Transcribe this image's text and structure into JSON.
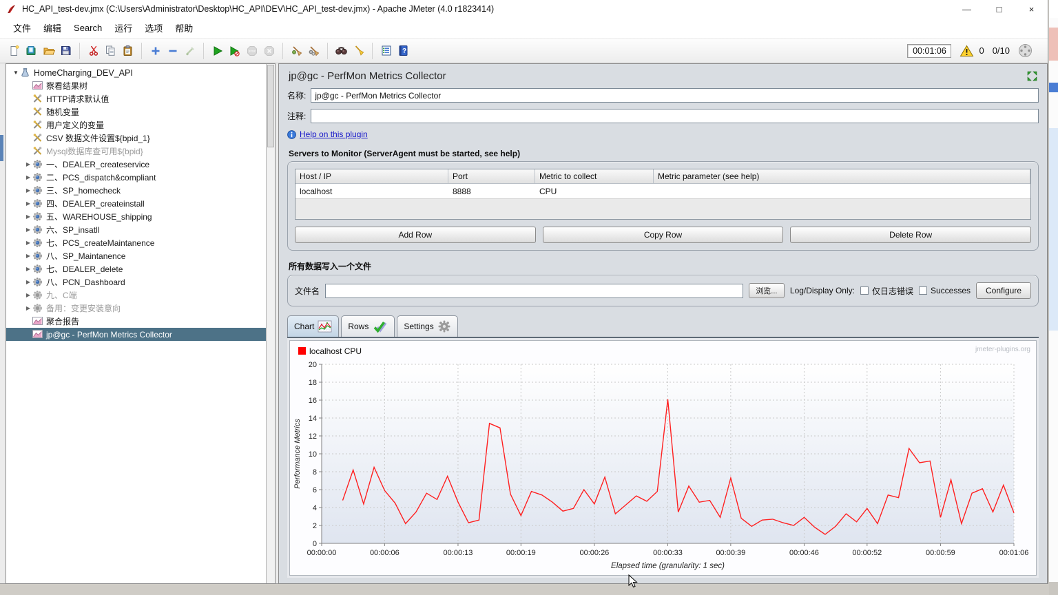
{
  "window": {
    "title": "HC_API_test-dev.jmx (C:\\Users\\Administrator\\Desktop\\HC_API\\DEV\\HC_API_test-dev.jmx) - Apache JMeter (4.0 r1823414)",
    "minimize_glyph": "—",
    "maximize_glyph": "□",
    "close_glyph": "×"
  },
  "menu": {
    "items": [
      "文件",
      "编辑",
      "Search",
      "运行",
      "选项",
      "帮助"
    ]
  },
  "toolbar": {
    "groups": [
      [
        "new-file",
        "template",
        "open",
        "save"
      ],
      [
        "cut",
        "copy",
        "paste"
      ],
      [
        "expand",
        "collapse",
        "toggle"
      ],
      [
        "start",
        "start-no-pauses",
        "stop",
        "shutdown"
      ],
      [
        "clear",
        "clear-all"
      ],
      [
        "search",
        "search-reset"
      ],
      [
        "function-helper",
        "help"
      ]
    ],
    "disabled": [
      "toggle",
      "stop",
      "shutdown"
    ],
    "timer": "00:01:06",
    "warning_count": "0",
    "thread_ratio": "0/10"
  },
  "tree": {
    "root": "HomeCharging_DEV_API",
    "items": [
      {
        "label": "察看结果树",
        "icon": "chart"
      },
      {
        "label": "HTTP请求默认值",
        "icon": "wrench"
      },
      {
        "label": "随机变量",
        "icon": "wrench"
      },
      {
        "label": "用户定义的变量",
        "icon": "wrench"
      },
      {
        "label": "CSV 数据文件设置${bpid_1}",
        "icon": "wrench"
      },
      {
        "label": "Mysql数据库查可用${bpid}",
        "icon": "wrench",
        "disabled": true
      },
      {
        "label": "一、DEALER_createservice",
        "icon": "gear-blue",
        "arrow": true
      },
      {
        "label": "二、PCS_dispatch&compliant",
        "icon": "gear-blue",
        "arrow": true
      },
      {
        "label": "三、SP_homecheck",
        "icon": "gear-blue",
        "arrow": true
      },
      {
        "label": "四、DEALER_createinstall",
        "icon": "gear-blue",
        "arrow": true
      },
      {
        "label": "五、WAREHOUSE_shipping",
        "icon": "gear-blue",
        "arrow": true
      },
      {
        "label": "六、SP_insatll",
        "icon": "gear-blue",
        "arrow": true
      },
      {
        "label": "七、PCS_createMaintanence",
        "icon": "gear-blue",
        "arrow": true
      },
      {
        "label": "八、SP_Maintanence",
        "icon": "gear-blue",
        "arrow": true
      },
      {
        "label": "七、DEALER_delete",
        "icon": "gear-blue",
        "arrow": true
      },
      {
        "label": "八、PCN_Dashboard",
        "icon": "gear-blue",
        "arrow": true
      },
      {
        "label": "九、C端",
        "icon": "gear-gray",
        "arrow": true,
        "disabled": true
      },
      {
        "label": "备用：变更安装意向",
        "icon": "gear-gray",
        "arrow": true,
        "disabled": true
      },
      {
        "label": "聚合报告",
        "icon": "chart"
      },
      {
        "label": "jp@gc - PerfMon Metrics Collector",
        "icon": "chart",
        "selected": true
      }
    ]
  },
  "main": {
    "panel_title": "jp@gc - PerfMon Metrics Collector",
    "name_label": "名称:",
    "name_value": "jp@gc - PerfMon Metrics Collector",
    "comment_label": "注释:",
    "comment_value": "",
    "help_link": "Help on this plugin",
    "servers_section": {
      "title": "Servers to Monitor (ServerAgent must be started, see help)",
      "columns": [
        "Host / IP",
        "Port",
        "Metric to collect",
        "Metric parameter (see help)"
      ],
      "rows": [
        [
          "localhost",
          "8888",
          "CPU",
          ""
        ]
      ],
      "buttons": [
        "Add Row",
        "Copy Row",
        "Delete Row"
      ]
    },
    "file_section": {
      "title": "所有数据写入一个文件",
      "filename_label": "文件名",
      "filename_value": "",
      "browse_label": "浏览...",
      "log_display_label": "Log/Display Only:",
      "checkbox_errors": "仅日志错误",
      "checkbox_successes": "Successes",
      "configure_label": "Configure"
    },
    "tabs": [
      {
        "label": "Chart",
        "icon": "chart-tab",
        "selected": true
      },
      {
        "label": "Rows",
        "icon": "rows-tab",
        "selected": false
      },
      {
        "label": "Settings",
        "icon": "settings-tab",
        "selected": false
      }
    ]
  },
  "chart_data": {
    "type": "line",
    "legend": [
      {
        "name": "localhost CPU",
        "color": "#ff0000"
      }
    ],
    "watermark": "jmeter-plugins.org",
    "xlabel": "Elapsed time (granularity: 1 sec)",
    "ylabel": "Performance Metrics",
    "ylim": [
      0,
      20
    ],
    "y_ticks": [
      0,
      2,
      4,
      6,
      8,
      10,
      12,
      14,
      16,
      18,
      20
    ],
    "x_ticks": [
      "00:00:00",
      "00:00:06",
      "00:00:13",
      "00:00:19",
      "00:00:26",
      "00:00:33",
      "00:00:39",
      "00:00:46",
      "00:00:52",
      "00:00:59",
      "00:01:06"
    ],
    "x_total_seconds": 66,
    "grid": true,
    "series": [
      {
        "name": "localhost CPU",
        "color": "#ff2020",
        "x_start_seconds": 2,
        "x_step_seconds": 1,
        "values": [
          4.8,
          8.2,
          4.4,
          8.5,
          5.9,
          4.5,
          2.2,
          3.5,
          5.6,
          4.9,
          7.5,
          4.6,
          2.3,
          2.6,
          13.4,
          12.9,
          5.5,
          3.1,
          5.8,
          5.4,
          4.6,
          3.6,
          3.9,
          6.0,
          4.4,
          7.4,
          3.3,
          4.3,
          5.3,
          4.7,
          5.8,
          16.1,
          3.5,
          6.4,
          4.6,
          4.8,
          2.9,
          7.3,
          2.8,
          1.9,
          2.6,
          2.7,
          2.3,
          2.0,
          2.9,
          1.8,
          1.0,
          1.9,
          3.3,
          2.4,
          3.9,
          2.2,
          5.4,
          5.1,
          10.6,
          9.0,
          9.2,
          2.9,
          7.1,
          2.2,
          5.6,
          6.1,
          3.5,
          6.5,
          3.4
        ]
      }
    ]
  }
}
